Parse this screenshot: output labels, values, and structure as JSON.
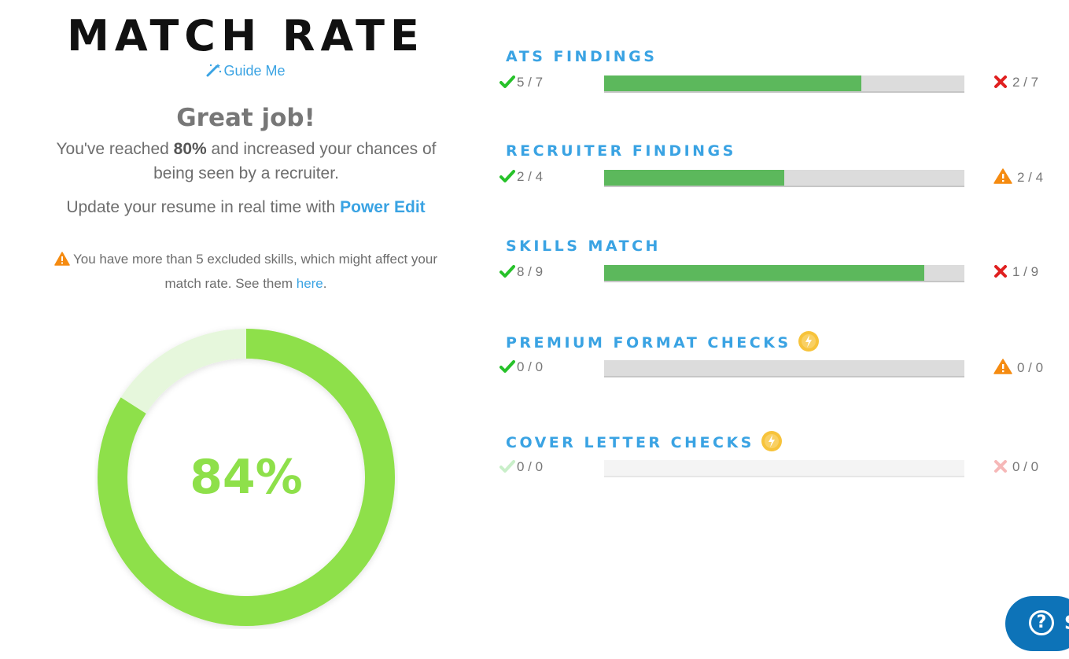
{
  "left": {
    "title": "MATCH RATE",
    "guide_label": "Guide Me",
    "heading": "Great job!",
    "reached_pre": "You've reached ",
    "reached_pct": "80%",
    "reached_post": " and increased your chances of being seen by a recruiter.",
    "update_pre": "Update your resume in real time with ",
    "update_link": "Power Edit",
    "warning_pre": "You have more than 5 excluded skills, which might affect your match rate. See them ",
    "warning_link": "here",
    "warning_post": ".",
    "score_label": "84%",
    "score_value": 84
  },
  "sections": [
    {
      "title": "ATS FINDINGS",
      "pass": "5 / 7",
      "fail": "2 / 7",
      "fill": 0.714,
      "fail_icon": "x-icon",
      "premium": false
    },
    {
      "title": "RECRUITER FINDINGS",
      "pass": "2 / 4",
      "fail": "2 / 4",
      "fill": 0.5,
      "fail_icon": "warning-icon",
      "premium": false
    },
    {
      "title": "SKILLS MATCH",
      "pass": "8 / 9",
      "fail": "1 / 9",
      "fill": 0.889,
      "fail_icon": "x-icon",
      "premium": false
    },
    {
      "title": "PREMIUM FORMAT CHECKS",
      "pass": "0 / 0",
      "fail": "0 / 0",
      "fill": 0,
      "fail_icon": "warning-icon",
      "premium": true
    },
    {
      "title": "COVER LETTER CHECKS",
      "pass": "0 / 0",
      "fail": "0 / 0",
      "fill": 0,
      "fail_icon": "x-icon",
      "premium": true,
      "faded": true
    }
  ],
  "help_button": {
    "glyph": "?",
    "label": "S"
  },
  "colors": {
    "accent": "#3aa3e3",
    "donut": "#8ee04a",
    "donut_bg": "#e6f7dc",
    "bar_fill": "#5cb85c",
    "check": "#27c22a",
    "x": "#e02020",
    "warn": "#f58b11",
    "bolt": "#f7c33b"
  }
}
